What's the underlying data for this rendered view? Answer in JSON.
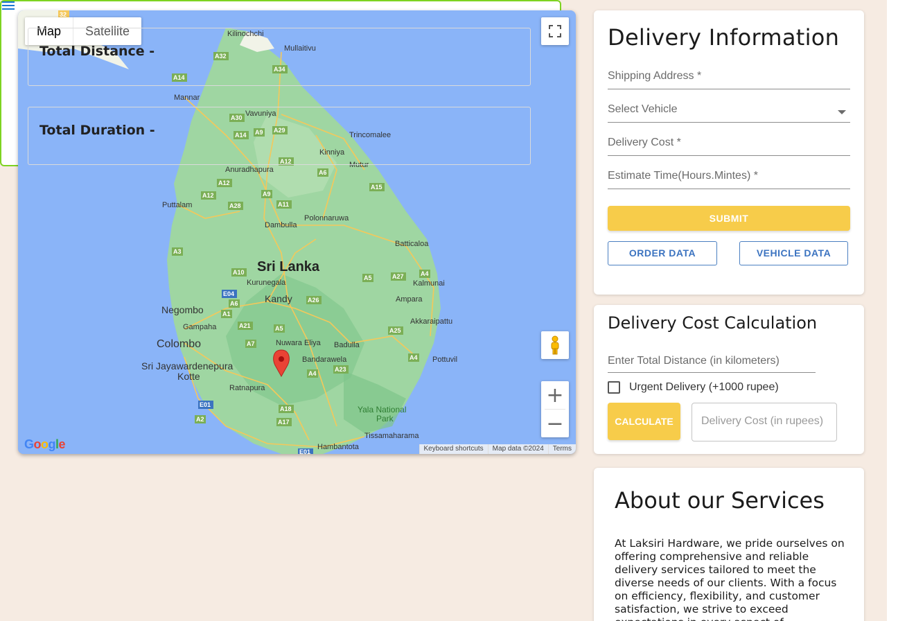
{
  "nav": {
    "menu_icon": "hamburger-menu-icon"
  },
  "map": {
    "type_controls": {
      "map_label": "Map",
      "satellite_label": "Satellite",
      "selected": "Map"
    },
    "country_label": "Sri Lanka",
    "places": [
      "Kilinochchi",
      "Mullaitivu",
      "Mannar",
      "Vavuniya",
      "Trincomalee",
      "Kinniya",
      "Mutur",
      "Anuradhapura",
      "Puttalam",
      "Polonnaruwa",
      "Dambulla",
      "Batticaloa",
      "Kurunegala",
      "Kalmunai",
      "Kandy",
      "Negombo",
      "Ampara",
      "Gampaha",
      "Akkaraipattu",
      "Colombo",
      "Nuwara Eliya",
      "Badulla",
      "Sri Jayawardenepura",
      "Kotte",
      "Bandarawela",
      "Pottuvil",
      "Ratnapura",
      "Yala National",
      "Park",
      "Tissamaharama",
      "Hambantota"
    ],
    "road_badges": [
      "A32",
      "A34",
      "A14",
      "A30",
      "A9",
      "A29",
      "A14",
      "A12",
      "A12",
      "A6",
      "A12",
      "A28",
      "A9",
      "A11",
      "A15",
      "A12",
      "A3",
      "A10",
      "A5",
      "A27",
      "A4",
      "E04",
      "A6",
      "A26",
      "A1",
      "A21",
      "A5",
      "A25",
      "A7",
      "A4",
      "A23",
      "E01",
      "A18",
      "A2",
      "A17",
      "E01",
      "32",
      "A6"
    ],
    "footer": {
      "shortcuts": "Keyboard shortcuts",
      "data": "Map data ©2024",
      "terms": "Terms"
    },
    "logo": "Google",
    "controls": {
      "zoom_in": "+",
      "zoom_out": "−"
    },
    "marker_color": "#ea4335",
    "water_color": "#8ab4f8",
    "land_color": "#9fd6a2"
  },
  "delivery_info": {
    "title": "Delivery Information",
    "shipping_address_label": "Shipping Address *",
    "vehicle_label": "Select Vehicle",
    "cost_label": "Delivery Cost *",
    "time_label": "Estimate Time(Hours.Mintes) *",
    "submit_label": "SUBMIT",
    "order_data_label": "ORDER DATA",
    "vehicle_data_label": "VEHICLE DATA"
  },
  "cost_calc": {
    "title": "Delivery Cost Calculation",
    "distance_placeholder": "Enter Total Distance (in kilometers)",
    "urgent_label": "Urgent Delivery (+1000 rupee)",
    "calculate_label": "CALCULATE",
    "cost_placeholder": "Delivery Cost (in rupees)"
  },
  "stats": {
    "total_distance_label": "Total Distance -",
    "total_duration_label": "Total Duration -"
  },
  "about": {
    "title": "About our Services",
    "body": "At Laksiri Hardware, we pride ourselves on offering comprehensive and reliable delivery services tailored to meet the diverse needs of our clients. With a focus on efficiency, flexibility, and customer satisfaction, we strive to exceed expectations in every aspect of"
  },
  "colors": {
    "accent_yellow": "#f7cc4a",
    "accent_blue": "#3b73c0",
    "stats_border": "#7ed321",
    "background": "#f6ebe2"
  }
}
